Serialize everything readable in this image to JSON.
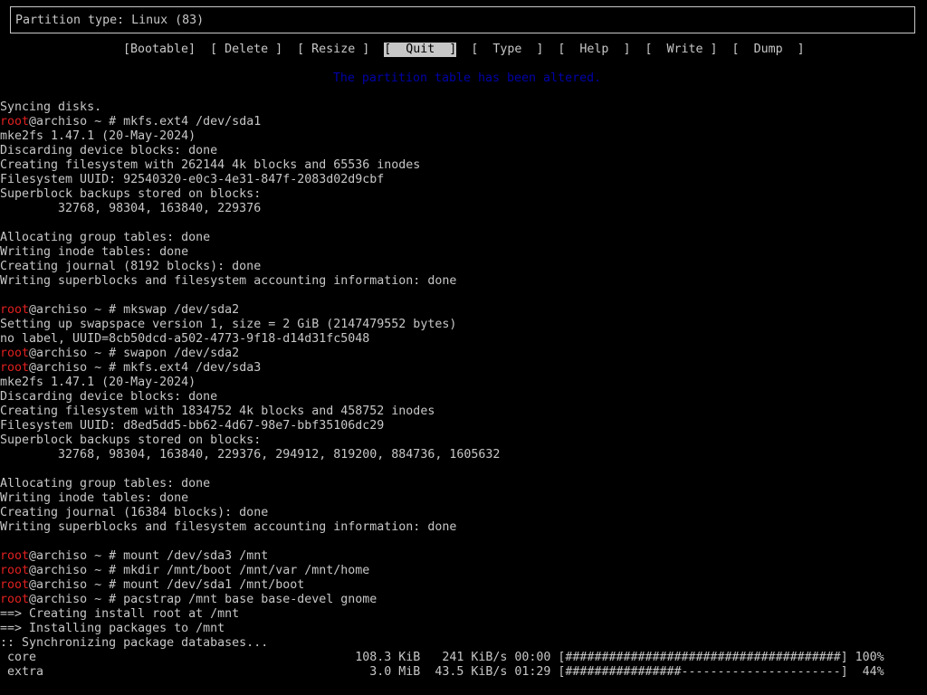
{
  "partition_type": "Partition type: Linux (83)",
  "menu": [
    {
      "label": "[Bootable]",
      "selected": false
    },
    {
      "label": "[ Delete ]",
      "selected": false
    },
    {
      "label": "[ Resize ]",
      "selected": false
    },
    {
      "label": "[  Quit  ]",
      "selected": true
    },
    {
      "label": "[  Type  ]",
      "selected": false
    },
    {
      "label": "[  Help  ]",
      "selected": false
    },
    {
      "label": "[  Write ]",
      "selected": false
    },
    {
      "label": "[  Dump  ]",
      "selected": false
    }
  ],
  "status_message": "The partition table has been altered.",
  "terminal_lines": [
    {
      "text": "Syncing disks."
    },
    {
      "user": "root",
      "text": "@archiso ~ # mkfs.ext4 /dev/sda1"
    },
    {
      "text": "mke2fs 1.47.1 (20-May-2024)"
    },
    {
      "text": "Discarding device blocks: done"
    },
    {
      "text": "Creating filesystem with 262144 4k blocks and 65536 inodes"
    },
    {
      "text": "Filesystem UUID: 92540320-e0c3-4e31-847f-2083d02d9cbf"
    },
    {
      "text": "Superblock backups stored on blocks:"
    },
    {
      "text": "        32768, 98304, 163840, 229376"
    },
    {
      "text": ""
    },
    {
      "text": "Allocating group tables: done"
    },
    {
      "text": "Writing inode tables: done"
    },
    {
      "text": "Creating journal (8192 blocks): done"
    },
    {
      "text": "Writing superblocks and filesystem accounting information: done"
    },
    {
      "text": ""
    },
    {
      "user": "root",
      "text": "@archiso ~ # mkswap /dev/sda2"
    },
    {
      "text": "Setting up swapspace version 1, size = 2 GiB (2147479552 bytes)"
    },
    {
      "text": "no label, UUID=8cb50dcd-a502-4773-9f18-d14d31fc5048"
    },
    {
      "user": "root",
      "text": "@archiso ~ # swapon /dev/sda2"
    },
    {
      "user": "root",
      "text": "@archiso ~ # mkfs.ext4 /dev/sda3"
    },
    {
      "text": "mke2fs 1.47.1 (20-May-2024)"
    },
    {
      "text": "Discarding device blocks: done"
    },
    {
      "text": "Creating filesystem with 1834752 4k blocks and 458752 inodes"
    },
    {
      "text": "Filesystem UUID: d8ed5dd5-bb62-4d67-98e7-bbf35106dc29"
    },
    {
      "text": "Superblock backups stored on blocks:"
    },
    {
      "text": "        32768, 98304, 163840, 229376, 294912, 819200, 884736, 1605632"
    },
    {
      "text": ""
    },
    {
      "text": "Allocating group tables: done"
    },
    {
      "text": "Writing inode tables: done"
    },
    {
      "text": "Creating journal (16384 blocks): done"
    },
    {
      "text": "Writing superblocks and filesystem accounting information: done"
    },
    {
      "text": ""
    },
    {
      "user": "root",
      "text": "@archiso ~ # mount /dev/sda3 /mnt"
    },
    {
      "user": "root",
      "text": "@archiso ~ # mkdir /mnt/boot /mnt/var /mnt/home"
    },
    {
      "user": "root",
      "text": "@archiso ~ # mount /dev/sda1 /mnt/boot"
    },
    {
      "user": "root",
      "text": "@archiso ~ # pacstrap /mnt base base-devel gnome"
    },
    {
      "text": "==> Creating install root at /mnt"
    },
    {
      "text": "==> Installing packages to /mnt"
    },
    {
      "text": ":: Synchronizing package databases..."
    },
    {
      "text": " core                                            108.3 KiB   241 KiB/s 00:00 [######################################] 100%"
    },
    {
      "text": " extra                                             3.0 MiB  43.5 KiB/s 01:29 [################----------------------]  44%"
    }
  ],
  "colors": {
    "background": "#000000",
    "text": "#c7c7c7",
    "root_user": "#e02020",
    "status_message": "#0000a8",
    "selected_bg": "#c7c7c7"
  }
}
